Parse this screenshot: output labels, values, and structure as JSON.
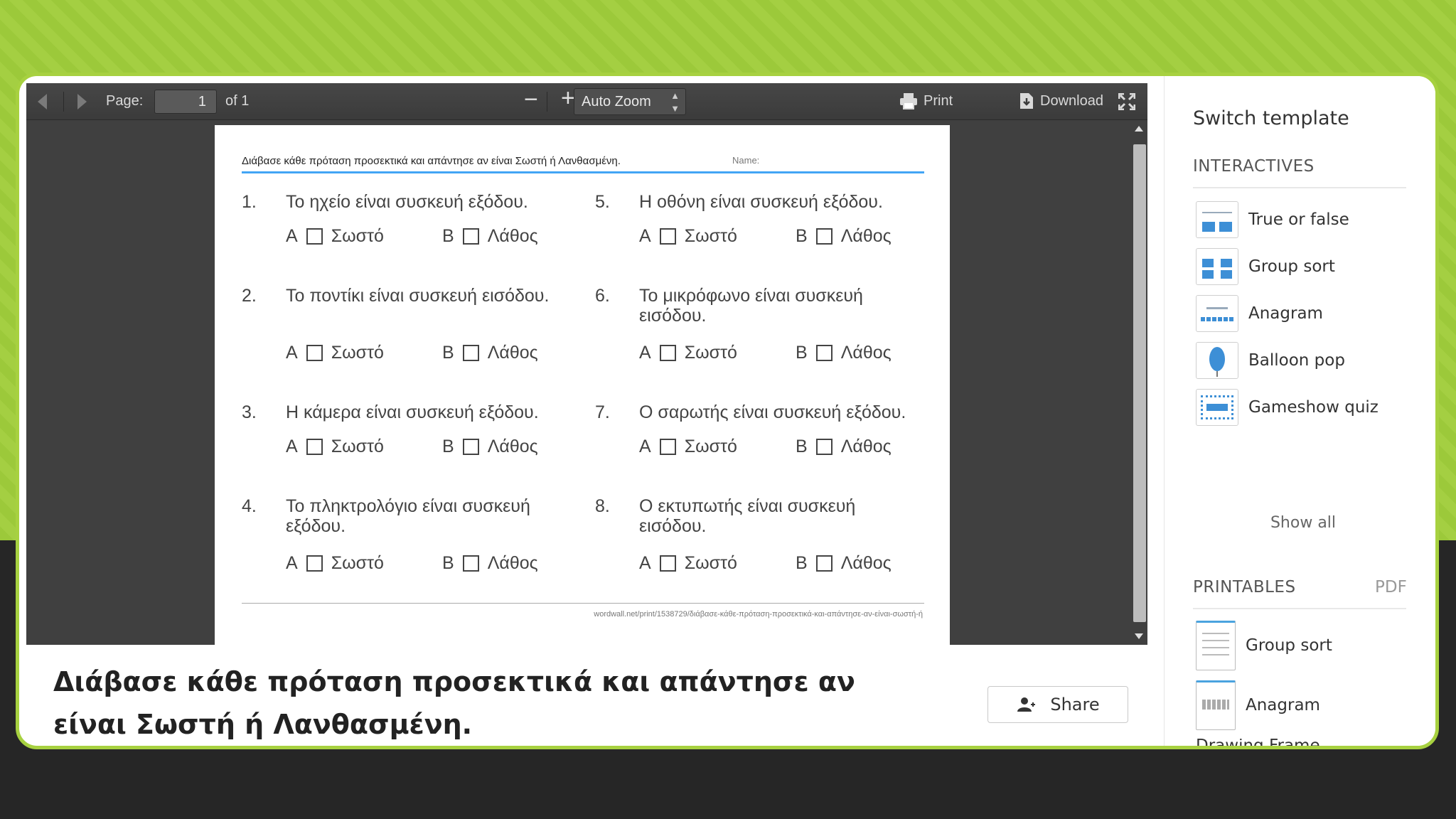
{
  "viewer": {
    "page_label": "Page:",
    "page_number": "1",
    "page_total": "of 1",
    "zoom_minus": "−",
    "zoom_plus": "+",
    "zoom_value": "Auto Zoom",
    "print_label": "Print",
    "download_label": "Download"
  },
  "worksheet": {
    "title": "Διάβασε κάθε πρόταση προσεκτικά και απάντησε αν είναι Σωστή ή Λανθασμένη.",
    "name_label": "Name:",
    "url": "wordwall.net/print/1538729/διάβασε-κάθε-πρόταση-προσεκτικά-και-απάντησε-αν-είναι-σωστή-ή",
    "option_a_letter": "A",
    "option_a_text": "Σωστό",
    "option_b_letter": "B",
    "option_b_text": "Λάθος",
    "questions": [
      {
        "num": "1.",
        "text": "Το ηχείο είναι συσκευή εξόδου."
      },
      {
        "num": "2.",
        "text": "Το ποντίκι είναι συσκευή εισόδου."
      },
      {
        "num": "3.",
        "text": "Η κάμερα είναι συσκευή εξόδου."
      },
      {
        "num": "4.",
        "text": "Το πληκτρολόγιο είναι συσκευή εξόδου."
      },
      {
        "num": "5.",
        "text": "Η οθόνη είναι συσκευή εξόδου."
      },
      {
        "num": "6.",
        "text": "Το μικρόφωνο είναι συσκευή εισόδου."
      },
      {
        "num": "7.",
        "text": "Ο σαρωτής είναι συσκευή εξόδου."
      },
      {
        "num": "8.",
        "text": "Ο εκτυπωτής είναι συσκευή εισόδου."
      }
    ]
  },
  "caption": "Διάβασε κάθε πρόταση προσεκτικά και απάντησε αν είναι Σωστή ή Λανθασμένη.",
  "share_label": "Share",
  "sidebar": {
    "title": "Switch template",
    "interactives_heading": "INTERACTIVES",
    "interactives": [
      "True or false",
      "Group sort",
      "Anagram",
      "Balloon pop",
      "Gameshow quiz"
    ],
    "show_all": "Show all",
    "printables_heading": "PRINTABLES",
    "pdf_label": "PDF",
    "printables": [
      "Group sort",
      "Anagram",
      "Drawing Frame"
    ]
  },
  "colors": {
    "background_green": "#a4cf42",
    "accent_blue": "#2196f3",
    "viewer_dark": "#404040"
  }
}
